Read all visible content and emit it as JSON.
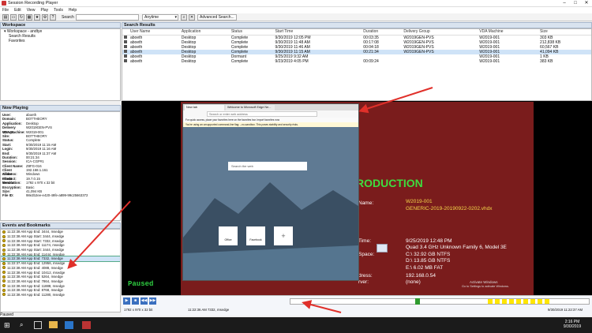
{
  "window": {
    "title": "Session Recording Player",
    "min": "–",
    "max": "□",
    "close": "✕"
  },
  "menu": [
    "File",
    "Edit",
    "View",
    "Play",
    "Tools",
    "Help"
  ],
  "toolbar": {
    "search_label": "Search",
    "search_value": "",
    "time_filter": "Anytime",
    "advanced_search": "Advanced Search..."
  },
  "workspace": {
    "header": "Workspace",
    "root": "Workspace - andtye",
    "items": [
      "Search Results",
      "Favorites"
    ]
  },
  "search_results": {
    "header": "Search Results",
    "columns": [
      "User Name",
      "Application",
      "Status",
      "Start Time",
      "Duration",
      "Delivery Group",
      "VDA Machine",
      "Size"
    ],
    "rows": [
      [
        "aboeth",
        "Desktop",
        "Complete",
        "9/30/2019 12:05 PM",
        "00:03:35",
        "W2019GEN-PVS",
        "W2019-001",
        "303 KB"
      ],
      [
        "aboeth",
        "Desktop",
        "Complete",
        "9/30/2019 11:48 AM",
        "00:17:08",
        "W2019GEN-PVS",
        "W2019-001",
        "212,838 KB"
      ],
      [
        "aboeth",
        "Desktop",
        "Complete",
        "9/30/2019 11:46 AM",
        "00:04:18",
        "W2019GEN-PVS",
        "W2019-001",
        "60,567 KB"
      ],
      [
        "aboeth",
        "Desktop",
        "Complete",
        "9/30/2019 11:15 AM",
        "00:21:34",
        "W2019GEN-PVS",
        "W2019-001",
        "41,094 KB"
      ],
      [
        "aboeth",
        "Desktop",
        "Dormant",
        "9/25/2019 9:32 AM",
        "",
        "",
        "W2019-001",
        "1 KB"
      ],
      [
        "aboeth",
        "Desktop",
        "Complete",
        "9/23/2019 4:05 PM",
        "00:09:24",
        "",
        "W2019-001",
        "383 KB"
      ]
    ]
  },
  "now_playing": {
    "header": "Now Playing",
    "fields": [
      [
        "User:",
        "aboeth"
      ],
      [
        "Domain:",
        "BOTTHEORY"
      ],
      [
        "Application:",
        "Desktop"
      ],
      [
        "Delivery Group:",
        "W2019GEN-PVS"
      ],
      [
        "VDA Machine:",
        "W2019-001"
      ],
      [
        "Site:",
        "BOTTHEORY"
      ],
      [
        "Status:",
        "Complete"
      ],
      [
        "Start:",
        "9/30/2019 11:15 AM"
      ],
      [
        "Login:",
        "9/30/2019 11:16 AM"
      ],
      [
        "End:",
        "9/30/2019 11:37 AM"
      ],
      [
        "Duration:",
        "00:21:34"
      ],
      [
        "Session:",
        "ICA-CGP#1"
      ],
      [
        "Client Name:",
        "Z8FG-016"
      ],
      [
        "Client Address:",
        "192.168.1.161"
      ],
      [
        "Client Product:",
        "Windows"
      ],
      [
        "Client Version:",
        "19.7.0.15"
      ],
      [
        "Resolution:",
        "1792 x 970 x 32 bit"
      ],
      [
        "Encryption:",
        "Basic"
      ],
      [
        "Size:",
        "41,094 KB"
      ],
      [
        "File ID:",
        "98e2b2ee-e420-49fe-a899-99c25663372"
      ]
    ]
  },
  "events": {
    "header": "Events and Bookmarks",
    "rows": [
      "11:22:38 AM App End: 3444, msedge",
      "11:22:38 AM App Start: 3444, msedge",
      "11:22:38 AM App Start: 7332, msedge",
      "11:22:38 AM App End: 11174, msedge",
      "11:22:38 AM App Start: 3444, msedge",
      "11:22:38 AM App End: 11444, msedge",
      "11:22:38 AM App End: 7332, msedge",
      "11:22:37 AM App End: 12956, msedge",
      "11:22:38 AM App End: 4088, msedge",
      "11:22:38 AM App End: 10412, msedge",
      "11:22:38 AM App End: 5264, msedge",
      "11:22:38 AM App End: 7864, msedge",
      "11:22:38 AM App End: 11888, msedge",
      "11:22:38 AM App End: 8768, msedge",
      "11:22:38 AM App End: 11280, msedge"
    ]
  },
  "player": {
    "paused_label": "Paused",
    "browser_tabs": [
      "New tab",
      "Welcome to Microsoft Edge Ne..."
    ],
    "address_placeholder": "Search or enter web address",
    "info_bar": "For quick access, place your favorites here on the favorites bar. Import favorites now",
    "warn_bar": "You're using an unsupported command-line flag: --no-sandbox. This poses stability and security risks.",
    "search_placeholder": "Search the web",
    "tiles": [
      "Office",
      "Facebook",
      "+"
    ],
    "background_lines": [
      "RODUCTION",
      "W2019-001",
      "GENERIC-2019-20190922-0202.vhdx",
      "9/25/2019 12:48 PM",
      "Quad 3.4 GHz Unknown Family 6, Model 3E",
      "C:\\ 32.92 GB NTFS",
      "D:\\ 13.85 GB NTFS",
      "E:\\ 6.02 MB FAT",
      "192.168.0.54",
      "(none)"
    ],
    "background_labels": [
      "Name:",
      "Time:",
      "Space:",
      "dress:",
      "rver:"
    ],
    "activate_windows": [
      "Activate Windows",
      "Go to Settings to activate Windows."
    ],
    "resolution": "1792 x 970 x 32 bit",
    "event_time": "11:22:36 AM 7332, msedge",
    "end_time": "9/30/2019 11:22:37 AM"
  },
  "status": "Paused",
  "taskbar": {
    "time": "2:16 PM",
    "date": "9/30/2019"
  }
}
